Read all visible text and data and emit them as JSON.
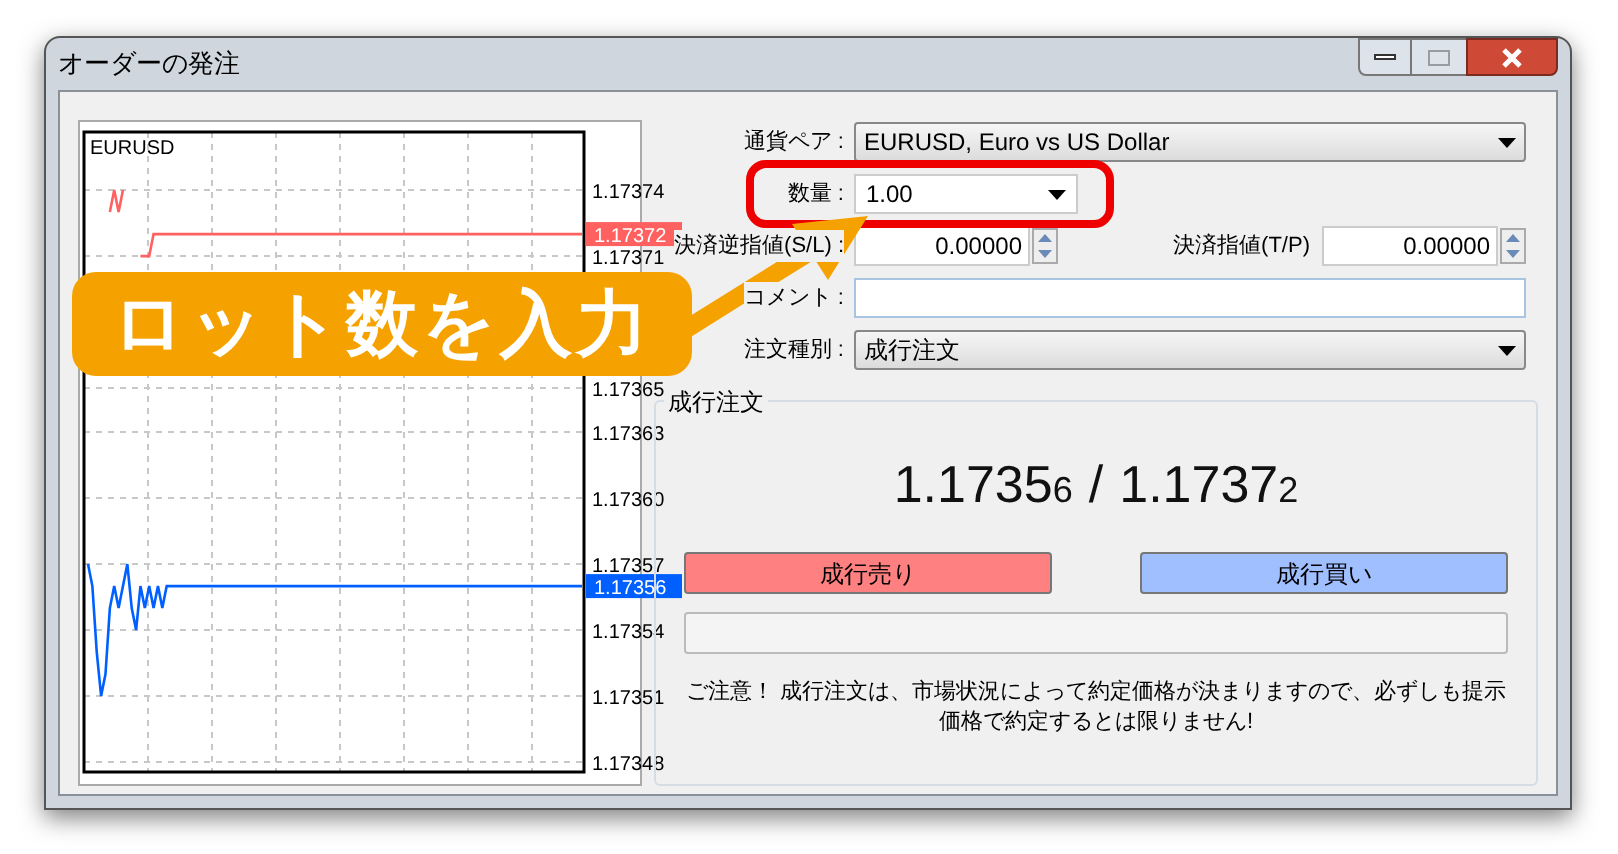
{
  "window": {
    "title": "オーダーの発注"
  },
  "window_controls": [
    {
      "kind": "minimize",
      "disabled": false
    },
    {
      "kind": "maximize",
      "disabled": true
    },
    {
      "kind": "close",
      "disabled": false
    }
  ],
  "chart": {
    "symbol": "EURUSD",
    "ask_marker": "1.17372",
    "bid_marker": "1.17356",
    "chart_data": {
      "type": "line",
      "grid": true,
      "ylim": [
        1.1734755,
        1.1737664
      ],
      "categories": [
        null,
        null,
        null,
        null,
        null,
        null,
        null,
        null,
        null,
        null,
        null,
        null,
        null,
        null,
        null,
        null,
        null,
        null,
        null,
        null,
        null,
        null,
        null,
        null,
        null,
        null,
        null,
        null,
        null,
        null,
        null,
        null,
        null,
        null,
        null,
        null,
        null,
        null,
        null,
        null,
        null,
        null,
        null,
        null,
        null,
        null,
        null,
        null,
        null,
        null,
        null,
        null,
        null,
        null,
        null,
        null,
        null,
        null,
        null,
        null,
        null,
        null,
        null,
        null,
        null,
        null,
        null,
        null,
        null,
        null,
        null,
        null,
        null,
        null,
        null,
        null,
        null,
        null,
        null,
        null,
        null,
        null,
        null,
        null,
        null,
        null,
        null,
        null,
        null,
        null,
        null,
        null,
        null,
        null,
        null,
        null,
        null,
        null,
        null,
        null,
        null,
        null,
        null,
        null,
        null,
        null,
        null,
        null,
        null,
        null,
        null,
        null,
        null,
        null
      ],
      "yticks": [
        {
          "value": 1.17374,
          "label": "1.17374"
        },
        {
          "value": 1.17371,
          "label": "1.17371"
        },
        {
          "value": 1.17365,
          "label": "1.17365"
        },
        {
          "value": 1.17363,
          "label": "1.17363"
        },
        {
          "value": 1.1736,
          "label": "1.17360"
        },
        {
          "value": 1.17357,
          "label": "1.17357"
        },
        {
          "value": 1.17354,
          "label": "1.17354"
        },
        {
          "value": 1.17351,
          "label": "1.17351"
        },
        {
          "value": 1.17348,
          "label": "1.17348"
        }
      ],
      "series": [
        {
          "color": "#ff6060",
          "values": [
            null,
            null,
            null,
            null,
            null,
            1.17373,
            1.17374,
            1.17373,
            1.17374,
            null,
            null,
            null,
            1.17371,
            1.17371,
            1.17371,
            1.17372,
            1.17372,
            1.17372,
            1.17372,
            1.17372,
            1.17372,
            1.17372,
            1.17372,
            1.17372,
            1.17372,
            1.17372,
            1.17372,
            1.17372,
            1.17372,
            1.17372,
            1.17372,
            1.17372,
            1.17372,
            1.17372,
            1.17372,
            1.17372,
            1.17372,
            1.17372,
            1.17372,
            1.17372,
            1.17372,
            1.17372,
            1.17372,
            1.17372,
            1.17372,
            1.17372,
            1.17372,
            1.17372,
            1.17372,
            1.17372,
            1.17372,
            1.17372,
            1.17372,
            1.17372,
            1.17372,
            1.17372,
            1.17372,
            1.17372,
            1.17372,
            1.17372,
            1.17372,
            1.17372,
            1.17372,
            1.17372,
            1.17372,
            1.17372,
            1.17372,
            1.17372,
            1.17372,
            1.17372,
            1.17372,
            1.17372,
            1.17372,
            1.17372,
            1.17372,
            1.17372,
            1.17372,
            1.17372,
            1.17372,
            1.17372,
            1.17372,
            1.17372,
            1.17372,
            1.17372,
            1.17372,
            1.17372,
            1.17372,
            1.17372,
            1.17372,
            1.17372,
            1.17372,
            1.17372,
            1.17372,
            1.17372,
            1.17372,
            1.17372,
            1.17372,
            1.17372,
            1.17372,
            1.17372,
            1.17372,
            1.17372,
            1.17372,
            1.17372,
            1.17372,
            1.17372,
            1.17372,
            1.17372,
            1.17372,
            1.17372,
            1.17372,
            1.17372,
            1.17372,
            1.17372
          ]
        },
        {
          "color": "#0060ff",
          "values": [
            1.17357,
            1.17356,
            1.17353,
            1.17351,
            1.17352,
            1.17355,
            1.17356,
            1.17355,
            1.17356,
            1.17357,
            1.17355,
            1.17354,
            1.17356,
            1.17355,
            1.17356,
            1.17355,
            1.17356,
            1.17355,
            1.17356,
            1.17356,
            1.17356,
            1.17356,
            1.17356,
            1.17356,
            1.17356,
            1.17356,
            1.17356,
            1.17356,
            1.17356,
            1.17356,
            1.17356,
            1.17356,
            1.17356,
            1.17356,
            1.17356,
            1.17356,
            1.17356,
            1.17356,
            1.17356,
            1.17356,
            1.17356,
            1.17356,
            1.17356,
            1.17356,
            1.17356,
            1.17356,
            1.17356,
            1.17356,
            1.17356,
            1.17356,
            1.17356,
            1.17356,
            1.17356,
            1.17356,
            1.17356,
            1.17356,
            1.17356,
            1.17356,
            1.17356,
            1.17356,
            1.17356,
            1.17356,
            1.17356,
            1.17356,
            1.17356,
            1.17356,
            1.17356,
            1.17356,
            1.17356,
            1.17356,
            1.17356,
            1.17356,
            1.17356,
            1.17356,
            1.17356,
            1.17356,
            1.17356,
            1.17356,
            1.17356,
            1.17356,
            1.17356,
            1.17356,
            1.17356,
            1.17356,
            1.17356,
            1.17356,
            1.17356,
            1.17356,
            1.17356,
            1.17356,
            1.17356,
            1.17356,
            1.17356,
            1.17356,
            1.17356,
            1.17356,
            1.17356,
            1.17356,
            1.17356,
            1.17356,
            1.17356,
            1.17356,
            1.17356,
            1.17356,
            1.17356,
            1.17356,
            1.17356,
            1.17356,
            1.17356,
            1.17356,
            1.17356,
            1.17356,
            1.17356,
            1.17356
          ]
        }
      ]
    }
  },
  "form": [
    {
      "kind": "dropdown",
      "label": "通貨ペア :",
      "value": "EURUSD, Euro vs US Dollar"
    },
    {
      "kind": "combo",
      "label": "数量 :",
      "value": "1.00"
    },
    {
      "kind": "spinners",
      "label": "決済逆指値(S/L) :",
      "value": "0.00000",
      "label_2": "決済指値(T/P)",
      "value_2": "0.00000"
    },
    {
      "kind": "text",
      "label": "コメント :"
    },
    {
      "kind": "dropdown",
      "label": "注文種別 :",
      "value": "成行注文"
    }
  ],
  "market_order": {
    "title": "成行注文",
    "bid": {
      "main": "1.1735",
      "last": "6"
    },
    "separator": "/",
    "ask": {
      "main": "1.1737",
      "last": "2"
    },
    "sell_button": "成行売り",
    "buy_button": "成行買い",
    "progress": {
      "level": 0
    },
    "notice": "ご注意！ 成行注文は、市場状況によって約定価格が決まりますので、必ずしも提示価格で約定するとは限りません!"
  },
  "annotation": {
    "callout": "ロット数を入力"
  }
}
